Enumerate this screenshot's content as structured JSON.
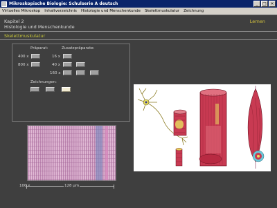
{
  "window": {
    "title": "Mikroskopische Biologie: Schulserie A deutsch",
    "controls": {
      "minimize": "_",
      "maximize": "□",
      "close": "×"
    }
  },
  "menu": [
    "Virtuelles Mikroskop",
    "Inhaltverzeichnis",
    "Histologie und Menschenkunde",
    "Skelettmuskulatur",
    "Zeichnung"
  ],
  "header": {
    "chapter": "Kapitel 2",
    "subject": "Histologie und Menschenkunde",
    "mode": "Lernen",
    "section": "Skelettmuskulatur"
  },
  "controls": {
    "praeparat_label": "Präparat:",
    "praeparat_rows": [
      "400 x",
      "800 x"
    ],
    "zusatz_label": "Zusatzpräparate:",
    "zusatz_rows": [
      "16 x",
      "40 x",
      "160 x"
    ],
    "zeichnungen_label": "Zeichnungen:",
    "active_drawing_index": 2
  },
  "micrograph": {
    "magnification": "100 x",
    "scale": "128 µm"
  },
  "colors": {
    "title_bar": "#0a246a",
    "background": "#3f3f3f",
    "accent_yellow": "#c8c838",
    "muscle_red": "#c83a52",
    "nerve_yellow": "#e8e060"
  }
}
